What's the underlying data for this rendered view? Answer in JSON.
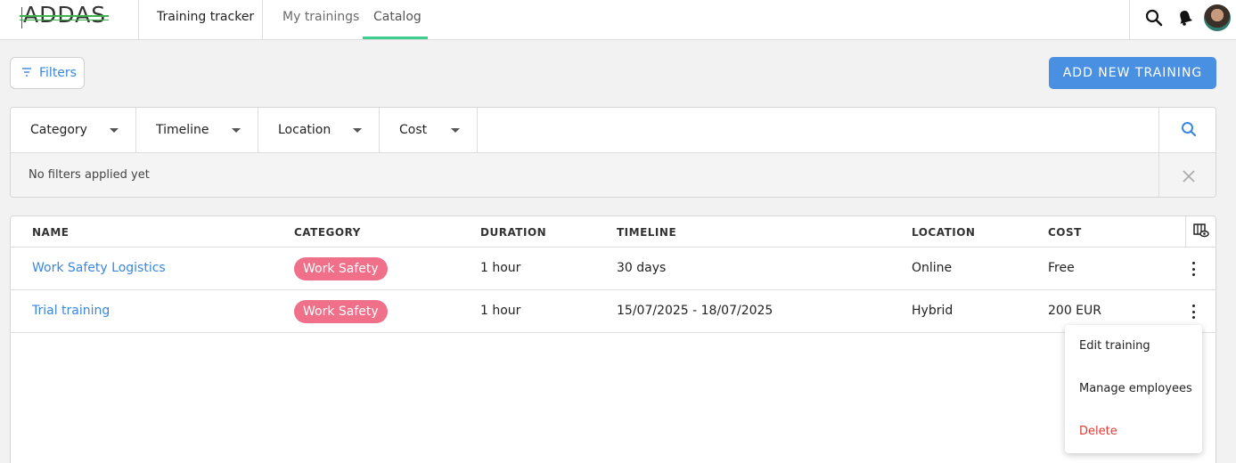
{
  "header": {
    "logo_text": "ADDAS",
    "app_title": "Training tracker",
    "tabs": [
      {
        "label": "My trainings",
        "active": false
      },
      {
        "label": "Catalog",
        "active": true
      }
    ],
    "icons": [
      "search-icon",
      "bell-icon",
      "avatar"
    ]
  },
  "toolbar": {
    "filters_label": "Filters",
    "add_label": "ADD NEW TRAINING"
  },
  "filters": {
    "dropdowns": [
      "Category",
      "Timeline",
      "Location",
      "Cost"
    ],
    "status": "No filters applied yet"
  },
  "table": {
    "columns": [
      "NAME",
      "CATEGORY",
      "DURATION",
      "TIMELINE",
      "LOCATION",
      "COST"
    ],
    "rows": [
      {
        "name": "Work Safety Logistics",
        "category": "Work Safety",
        "duration": "1 hour",
        "timeline": "30 days",
        "location": "Online",
        "cost": "Free"
      },
      {
        "name": "Trial training",
        "category": "Work Safety",
        "duration": "1 hour",
        "timeline": "15/07/2025 - 18/07/2025",
        "location": "Hybrid",
        "cost": "200 EUR"
      }
    ]
  },
  "menu": {
    "items": [
      {
        "label": "Edit training",
        "danger": false
      },
      {
        "label": "Manage employees",
        "danger": false
      },
      {
        "label": "Delete",
        "danger": true
      }
    ]
  },
  "colors": {
    "accent": "#4a90e2",
    "link": "#3a86e0",
    "tab_underline": "#3ecf8e",
    "badge": "#f0708a",
    "danger": "#e53935"
  }
}
